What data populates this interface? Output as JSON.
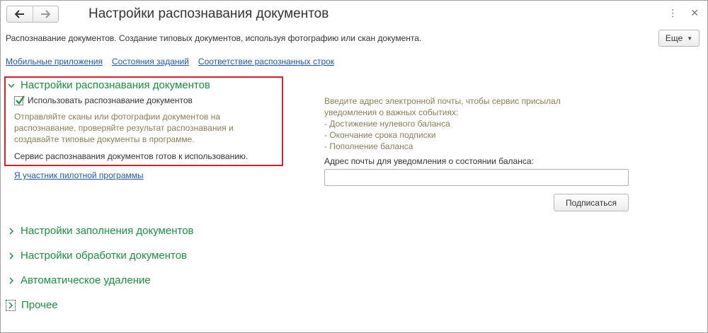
{
  "window": {
    "title": "Настройки распознавания документов",
    "nav": {
      "back_icon": "arrow-left-icon",
      "forward_icon": "arrow-right-icon"
    },
    "more_menu_icon": "vertical-dots-icon",
    "close_icon": "close-icon"
  },
  "header": {
    "description": "Распознавание документов. Создание типовых документов, используя фотографию или скан документа.",
    "more_button": "Еще"
  },
  "links": [
    {
      "label": "Мобильные приложения"
    },
    {
      "label": "Состояния заданий"
    },
    {
      "label": "Соответствие распознанных строк"
    }
  ],
  "recognition_group": {
    "title": "Настройки распознавания документов",
    "expanded": true,
    "checkbox_label": "Использовать распознавание документов",
    "checkbox_checked": true,
    "explanation": "Отправляйте сканы или фотографии документов на распознавание, проверяйте результат распознавания и создавайте типовые документы в программе.",
    "status": "Сервис распознавания документов готов к использованию.",
    "pilot_link": "Я участник пилотной программы"
  },
  "email": {
    "info_line1": "Введите адрес электронной почты, чтобы сервис присылал",
    "info_line2": "уведомления о важных событиях:",
    "info_line3": "- Достижение нулевого баланса",
    "info_line4": "- Окончание срока подписки",
    "info_line5": "- Пополнение баланса",
    "label": "Адрес почты для уведомления о состоянии баланса:",
    "value": "",
    "subscribe_button": "Подписаться"
  },
  "collapsed_groups": [
    {
      "title": "Настройки заполнения документов"
    },
    {
      "title": "Настройки обработки документов"
    },
    {
      "title": "Автоматическое удаление"
    },
    {
      "title": "Прочее"
    }
  ],
  "colors": {
    "accent_green": "#1a8f3c",
    "link_blue": "#1f5aa6",
    "highlight_red": "#cc2233",
    "hint_text": "#8a7d55"
  }
}
